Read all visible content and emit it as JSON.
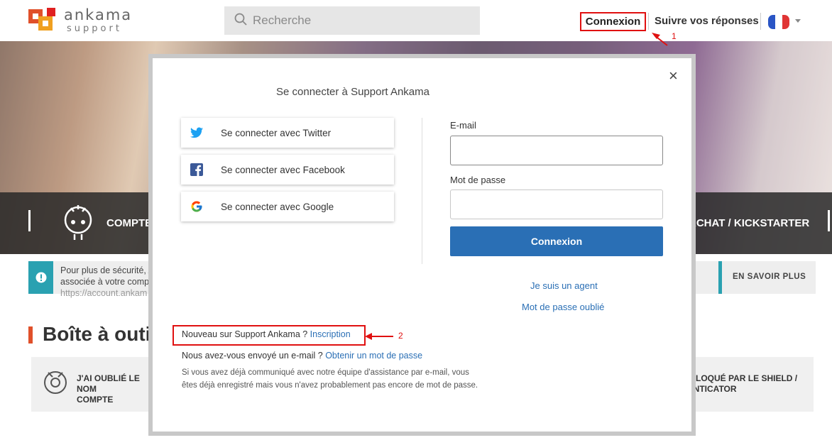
{
  "header": {
    "logo": {
      "line1": "ankama",
      "line2": "support"
    },
    "search_placeholder": "Recherche",
    "nav": {
      "login": "Connexion",
      "follow": "Suivre vos réponses"
    },
    "annotation_1": "1"
  },
  "hero": {
    "band_left_label": "COMPTE A",
    "band_right_label": "ACHAT / KICKSTARTER"
  },
  "alert": {
    "line1": "Pour plus de sécurité, A",
    "line2": "associée à votre compt",
    "line3": "https://account.ankam",
    "button": "EN SAVOIR PLUS"
  },
  "toolbox": {
    "title": "Boîte à outi",
    "card_left": {
      "line1": "J'AI OUBLIÉ LE NOM",
      "line2": "COMPTE"
    },
    "card_right": {
      "line1": "S BLOQUÉ PAR LE SHIELD /",
      "line2": "HENTICATOR"
    }
  },
  "modal": {
    "close": "×",
    "title": "Se connecter à Support Ankama",
    "social": {
      "twitter": "Se connecter avec Twitter",
      "facebook": "Se connecter avec Facebook",
      "google": "Se connecter avec Google"
    },
    "email_label": "E-mail",
    "email_value": "",
    "password_label": "Mot de passe",
    "password_value": "",
    "submit": "Connexion",
    "agent_link": "Je suis un agent",
    "forgot_link": "Mot de passe oublié",
    "signup_text": "Nouveau sur Support Ankama ? ",
    "signup_link": "Inscription",
    "annotation_2": "2",
    "email_question": "Nous avez-vous envoyé un e-mail ? ",
    "email_question_link": "Obtenir un mot de passe",
    "note": "Si vous avez déjà communiqué avec notre équipe d'assistance par e-mail, vous êtes déjà enregistré mais vous n'avez probablement pas encore de mot de passe."
  },
  "colors": {
    "accent_blue": "#2a6fb5",
    "alert_teal": "#2aa1b1",
    "annotation_red": "#e01010",
    "toolbox_orange": "#e0502a"
  },
  "icons": [
    "search-icon",
    "flag-fr-icon",
    "mascot-icon",
    "alert-icon",
    "twitter-icon",
    "facebook-icon",
    "google-icon",
    "close-icon",
    "card-icon"
  ]
}
